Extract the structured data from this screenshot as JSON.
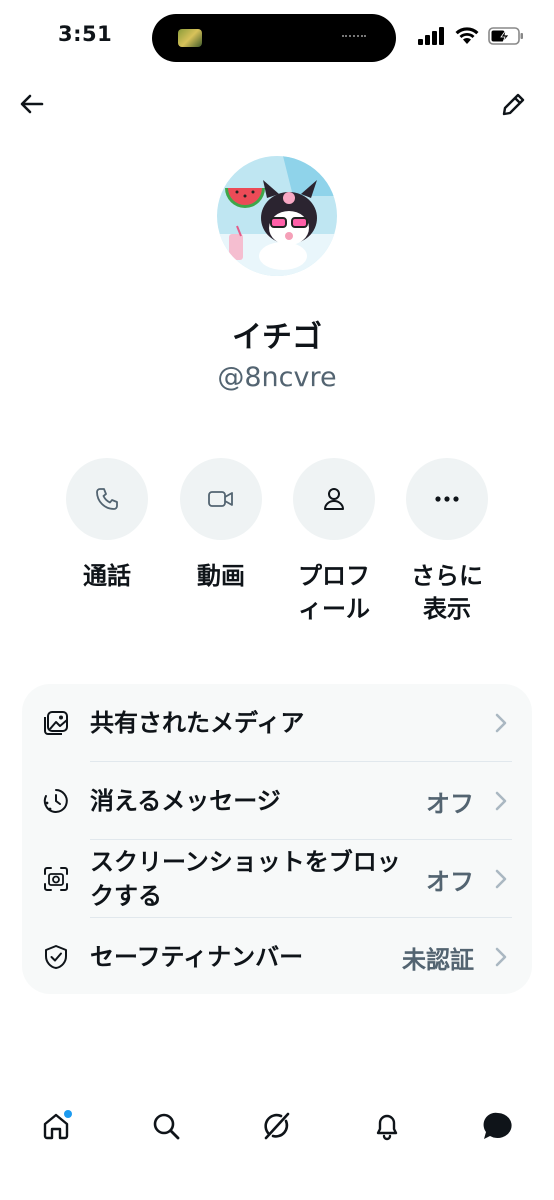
{
  "status_bar": {
    "time": "3:51",
    "icons": [
      "signal-icon",
      "wifi-icon",
      "battery-charging-icon"
    ]
  },
  "header": {
    "back_icon": "arrow-left-icon",
    "edit_icon": "pencil-icon"
  },
  "profile": {
    "display_name": "イチゴ",
    "username": "@8ncvre"
  },
  "actions": [
    {
      "label": "通話",
      "icon": "phone-icon"
    },
    {
      "label": "動画",
      "icon": "video-icon"
    },
    {
      "label": "プロフ\nィール",
      "icon": "person-icon"
    },
    {
      "label": "さらに\n表示",
      "icon": "more-icon"
    }
  ],
  "settings": [
    {
      "label": "共有されたメディア",
      "value": "",
      "icon": "media-icon"
    },
    {
      "label": "消えるメッセージ",
      "value": "オフ",
      "icon": "timer-icon"
    },
    {
      "label": "スクリーンショットをブロックする",
      "value": "オフ",
      "icon": "screenshot-icon"
    },
    {
      "label": "セーフティナンバー",
      "value": "未認証",
      "icon": "shield-icon"
    }
  ],
  "bottom_nav": [
    "home-icon",
    "search-icon",
    "grok-icon",
    "bell-icon",
    "messages-icon"
  ],
  "colors": {
    "text": "#0f1419",
    "secondary": "#536471",
    "card_bg": "#f7f9f9",
    "button_bg": "#eff3f4",
    "accent": "#1d9bf0"
  }
}
